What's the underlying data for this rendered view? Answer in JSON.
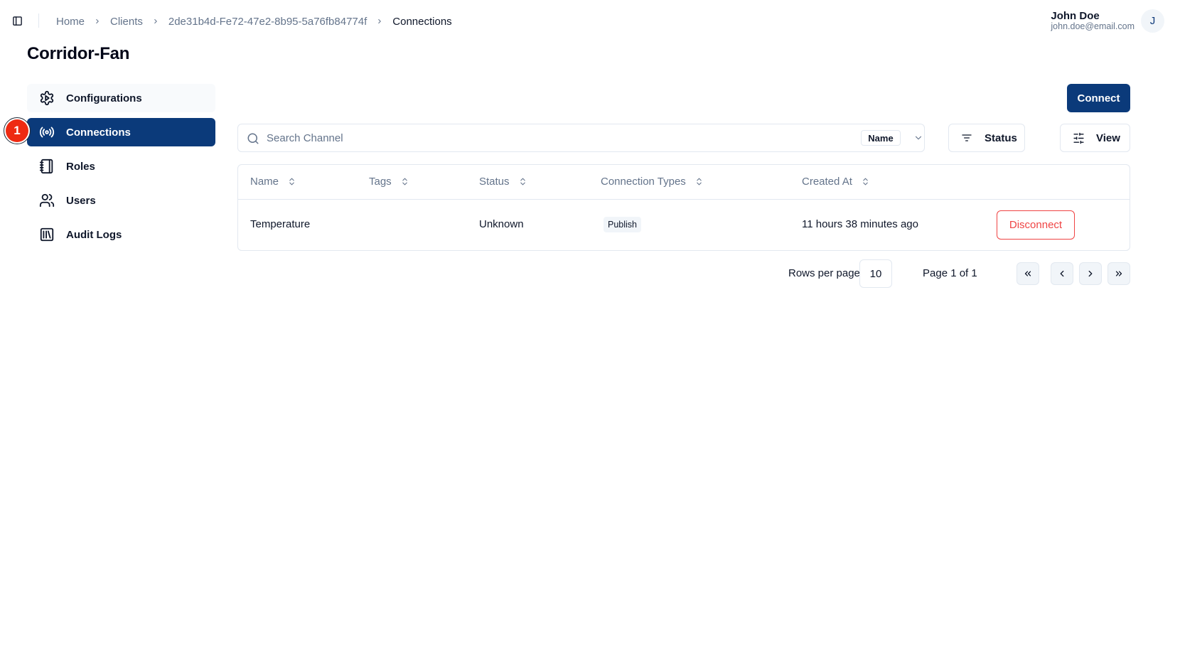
{
  "header": {
    "breadcrumb": [
      {
        "label": "Home"
      },
      {
        "label": "Clients"
      },
      {
        "label": "2de31b4d-Fe72-47e2-8b95-5a76fb84774f"
      },
      {
        "label": "Connections"
      }
    ],
    "user": {
      "name": "John Doe",
      "email": "john.doe@email.com",
      "initial": "J"
    }
  },
  "page": {
    "title": "Corridor-Fan"
  },
  "sidebar": {
    "items": [
      {
        "label": "Configurations",
        "icon": "settings-icon",
        "state": "hover"
      },
      {
        "label": "Connections",
        "icon": "radio-icon",
        "state": "active"
      },
      {
        "label": "Roles",
        "icon": "notebook-icon",
        "state": "default"
      },
      {
        "label": "Users",
        "icon": "users-icon",
        "state": "default"
      },
      {
        "label": "Audit Logs",
        "icon": "library-icon",
        "state": "default"
      }
    ],
    "step_badge": "1"
  },
  "toolbar": {
    "connect_label": "Connect",
    "search_placeholder": "Search Channel",
    "search_value": "",
    "search_field": "Name",
    "status_label": "Status",
    "view_label": "View"
  },
  "table": {
    "columns": [
      "Name",
      "Tags",
      "Status",
      "Connection Types",
      "Created At"
    ],
    "rows": [
      {
        "name": "Temperature",
        "tags": "",
        "status": "Unknown",
        "connection_types": [
          "Publish"
        ],
        "created_at": "11 hours 38 minutes ago",
        "action": "Disconnect"
      }
    ]
  },
  "pagination": {
    "rows_per_page_label": "Rows per page",
    "rows_per_page": "10",
    "page_text": "Page 1 of 1"
  },
  "colors": {
    "primary": "#0b3a7a",
    "danger": "#ef4444",
    "badge": "#ee2a12"
  }
}
